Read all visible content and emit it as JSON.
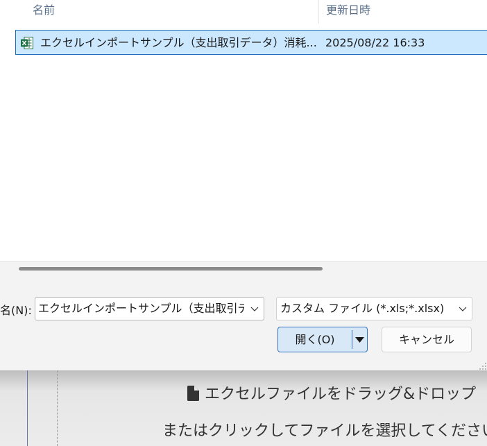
{
  "file_list": {
    "columns": {
      "name": "名前",
      "modified": "更新日時"
    },
    "rows": [
      {
        "name": "エクセルインポートサンプル（支出取引データ）消耗...",
        "modified": "2025/08/22 16:33",
        "icon": "excel-file-icon"
      }
    ]
  },
  "dialog": {
    "filename_label": "名(N):",
    "filename_value": "エクセルインポートサンプル（支出取引データ）消耗品費",
    "filetype_value": "カスタム ファイル (*.xls;*.xlsx)",
    "open_label": "開く(O)",
    "cancel_label": "キャンセル"
  },
  "dropzone": {
    "line1": "エクセルファイルをドラッグ&ドロップ",
    "line2": "またはクリックしてファイルを選択してください"
  },
  "colors": {
    "selection_bg": "#cce8ff",
    "selection_border": "#1b6bb5",
    "excel_green": "#1e7145",
    "dialog_bg": "#f3f3f3"
  }
}
